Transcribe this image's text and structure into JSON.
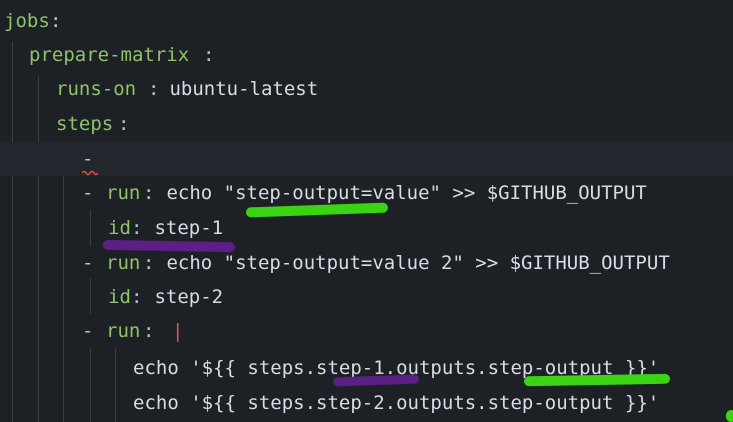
{
  "lines": [
    {
      "key": "jobs",
      "colon": ":"
    },
    {
      "key": "prepare-matrix",
      "colon": ":"
    },
    {
      "key": "runs-on",
      "colon": ":",
      "value": " ubuntu-latest"
    },
    {
      "key": "steps",
      "colon": ":"
    },
    {
      "dash": "-"
    },
    {
      "dash": "- ",
      "key": "run",
      "colon": ":",
      "value": " echo \"step-output=value\" >> $GITHUB_OUTPUT"
    },
    {
      "key": "id",
      "colon": ":",
      "value": " step-1"
    },
    {
      "dash": "- ",
      "key": "run",
      "colon": ":",
      "value": " echo \"step-output=value 2\" >> $GITHUB_OUTPUT"
    },
    {
      "key": "id",
      "colon": ":",
      "value": " step-2"
    },
    {
      "dash": "- ",
      "key": "run",
      "colon": ": ",
      "pipe": "|"
    },
    {
      "value": "echo '${{ steps.step-1.outputs.step-output }}'"
    },
    {
      "value": "echo '${{ steps.step-2.outputs.step-output }}'"
    }
  ],
  "colors": {
    "background": "#1d2025",
    "key": "#8fc36a",
    "value": "#d7dde4",
    "pipe": "#e5533d",
    "highlight_green": "#3bd415",
    "highlight_purple": "#5b1f86"
  }
}
